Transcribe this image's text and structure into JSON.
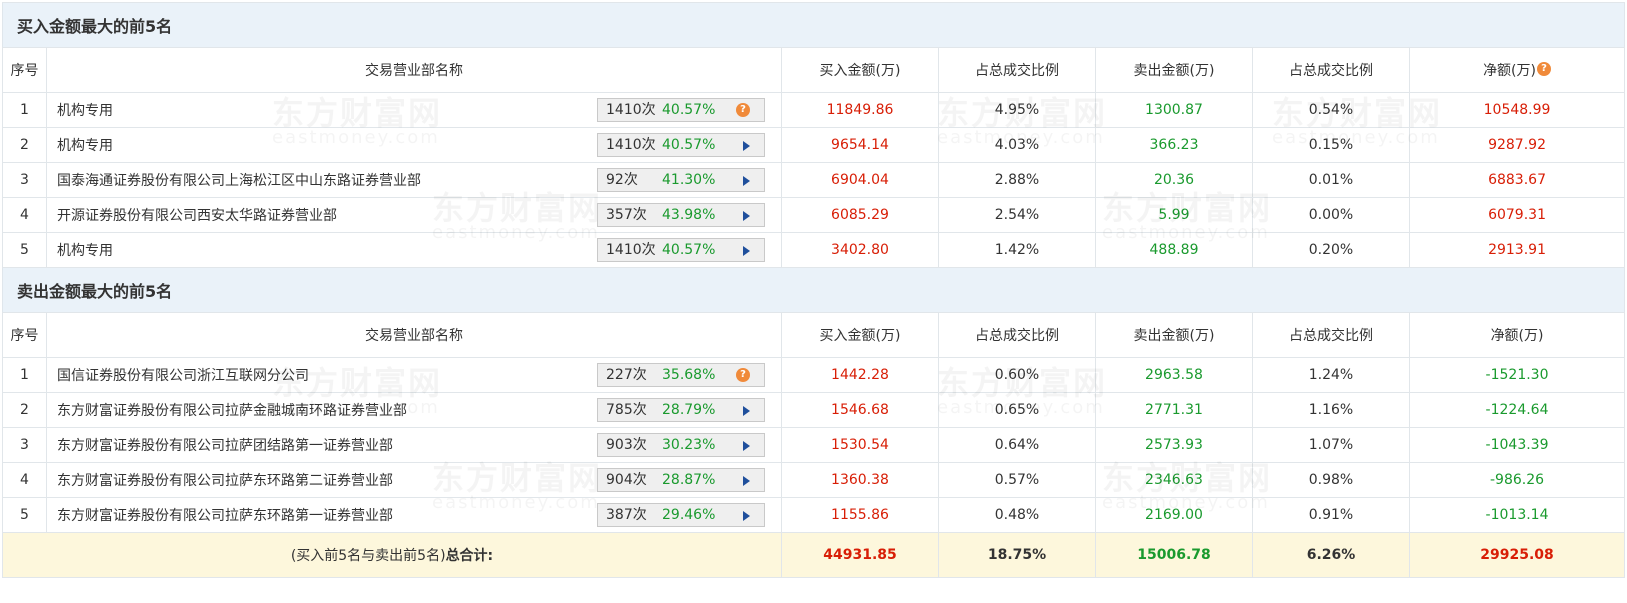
{
  "buy_section": {
    "title": "买入金额最大的前5名",
    "headers": {
      "seq": "序号",
      "name": "交易营业部名称",
      "buy": "买入金额(万)",
      "buy_ratio": "占总成交比例",
      "sell": "卖出金额(万)",
      "sell_ratio": "占总成交比例",
      "net": "净额(万)"
    },
    "rows": [
      {
        "seq": "1",
        "name": "机构专用",
        "count": "1410次",
        "pct": "40.57%",
        "buy": "11849.86",
        "buy_ratio": "4.95%",
        "sell": "1300.87",
        "sell_ratio": "0.54%",
        "net": "10548.99"
      },
      {
        "seq": "2",
        "name": "机构专用",
        "count": "1410次",
        "pct": "40.57%",
        "buy": "9654.14",
        "buy_ratio": "4.03%",
        "sell": "366.23",
        "sell_ratio": "0.15%",
        "net": "9287.92"
      },
      {
        "seq": "3",
        "name": "国泰海通证券股份有限公司上海松江区中山东路证券营业部",
        "count": "92次",
        "pct": "41.30%",
        "buy": "6904.04",
        "buy_ratio": "2.88%",
        "sell": "20.36",
        "sell_ratio": "0.01%",
        "net": "6883.67"
      },
      {
        "seq": "4",
        "name": "开源证券股份有限公司西安太华路证券营业部",
        "count": "357次",
        "pct": "43.98%",
        "buy": "6085.29",
        "buy_ratio": "2.54%",
        "sell": "5.99",
        "sell_ratio": "0.00%",
        "net": "6079.31"
      },
      {
        "seq": "5",
        "name": "机构专用",
        "count": "1410次",
        "pct": "40.57%",
        "buy": "3402.80",
        "buy_ratio": "1.42%",
        "sell": "488.89",
        "sell_ratio": "0.20%",
        "net": "2913.91"
      }
    ]
  },
  "sell_section": {
    "title": "卖出金额最大的前5名",
    "headers": {
      "seq": "序号",
      "name": "交易营业部名称",
      "buy": "买入金额(万)",
      "buy_ratio": "占总成交比例",
      "sell": "卖出金额(万)",
      "sell_ratio": "占总成交比例",
      "net": "净额(万)"
    },
    "rows": [
      {
        "seq": "1",
        "name": "国信证券股份有限公司浙江互联网分公司",
        "count": "227次",
        "pct": "35.68%",
        "buy": "1442.28",
        "buy_ratio": "0.60%",
        "sell": "2963.58",
        "sell_ratio": "1.24%",
        "net": "-1521.30"
      },
      {
        "seq": "2",
        "name": "东方财富证券股份有限公司拉萨金融城南环路证券营业部",
        "count": "785次",
        "pct": "28.79%",
        "buy": "1546.68",
        "buy_ratio": "0.65%",
        "sell": "2771.31",
        "sell_ratio": "1.16%",
        "net": "-1224.64"
      },
      {
        "seq": "3",
        "name": "东方财富证券股份有限公司拉萨团结路第一证券营业部",
        "count": "903次",
        "pct": "30.23%",
        "buy": "1530.54",
        "buy_ratio": "0.64%",
        "sell": "2573.93",
        "sell_ratio": "1.07%",
        "net": "-1043.39"
      },
      {
        "seq": "4",
        "name": "东方财富证券股份有限公司拉萨东环路第二证券营业部",
        "count": "904次",
        "pct": "28.87%",
        "buy": "1360.38",
        "buy_ratio": "0.57%",
        "sell": "2346.63",
        "sell_ratio": "0.98%",
        "net": "-986.26"
      },
      {
        "seq": "5",
        "name": "东方财富证券股份有限公司拉萨东环路第一证券营业部",
        "count": "387次",
        "pct": "29.46%",
        "buy": "1155.86",
        "buy_ratio": "0.48%",
        "sell": "2169.00",
        "sell_ratio": "0.91%",
        "net": "-1013.14"
      }
    ]
  },
  "total": {
    "label_prefix": "(买入前5名与卖出前5名)",
    "label_suffix": "总合计:",
    "buy": "44931.85",
    "buy_ratio": "18.75%",
    "sell": "15006.78",
    "sell_ratio": "6.26%",
    "net": "29925.08"
  },
  "icons": {
    "help": "?"
  },
  "colors": {
    "up": "#d81e06",
    "down": "#1a9a2e",
    "section_bg": "#eaf2f9",
    "total_bg": "#fdf7dc",
    "help_icon": "#f08a3a",
    "arrow": "#1f4f9c"
  }
}
